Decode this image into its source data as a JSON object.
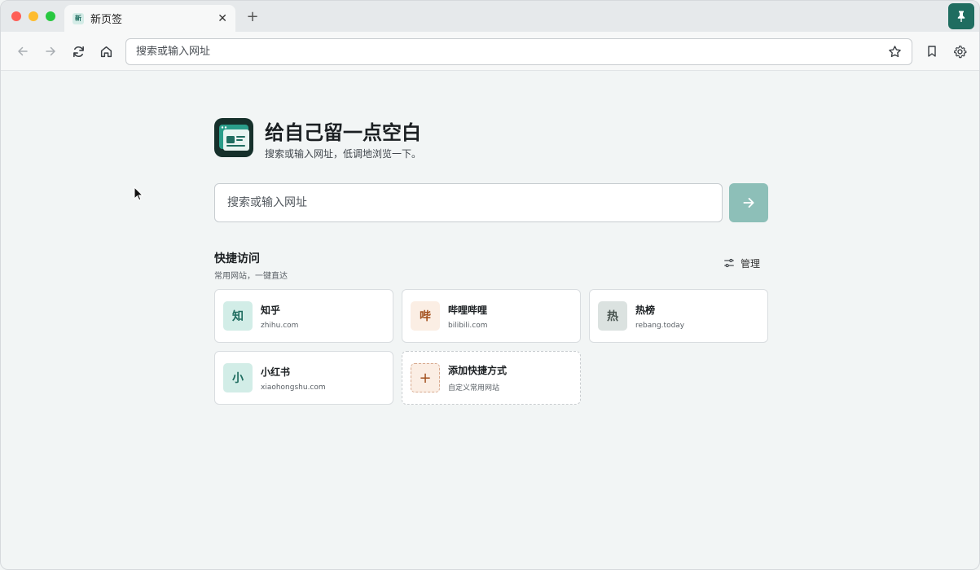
{
  "tab": {
    "title": "新页签",
    "favicon_text": "新",
    "close_symbol": "✕",
    "new_tab_symbol": "+"
  },
  "toolbar": {
    "address_placeholder": "搜索或输入网址"
  },
  "hero": {
    "title": "给自己留一点空白",
    "subtitle": "搜索或输入网址，低调地浏览一下。"
  },
  "search": {
    "placeholder": "搜索或输入网址"
  },
  "quick_access": {
    "title": "快捷访问",
    "subtitle": "常用网站，一键直达",
    "manage_label": "管理",
    "items": [
      {
        "icon_text": "知",
        "name": "知乎",
        "domain": "zhihu.com",
        "icon_bg": "#d2ede7",
        "icon_color": "#1f6d60"
      },
      {
        "icon_text": "哔",
        "name": "哔哩哔哩",
        "domain": "bilibili.com",
        "icon_bg": "#fbeee4",
        "icon_color": "#a24f1c"
      },
      {
        "icon_text": "热",
        "name": "热榜",
        "domain": "rebang.today",
        "icon_bg": "#dbe2e0",
        "icon_color": "#495450"
      },
      {
        "icon_text": "小",
        "name": "小红书",
        "domain": "xiaohongshu.com",
        "icon_bg": "#d2ede7",
        "icon_color": "#1f6d60"
      }
    ],
    "add": {
      "icon_text": "+",
      "name": "添加快捷方式",
      "subtitle": "自定义常用网站"
    }
  },
  "colors": {
    "accent": "#1f6d60",
    "go_button": "#8dbfb8",
    "background": "#f2f5f5"
  }
}
